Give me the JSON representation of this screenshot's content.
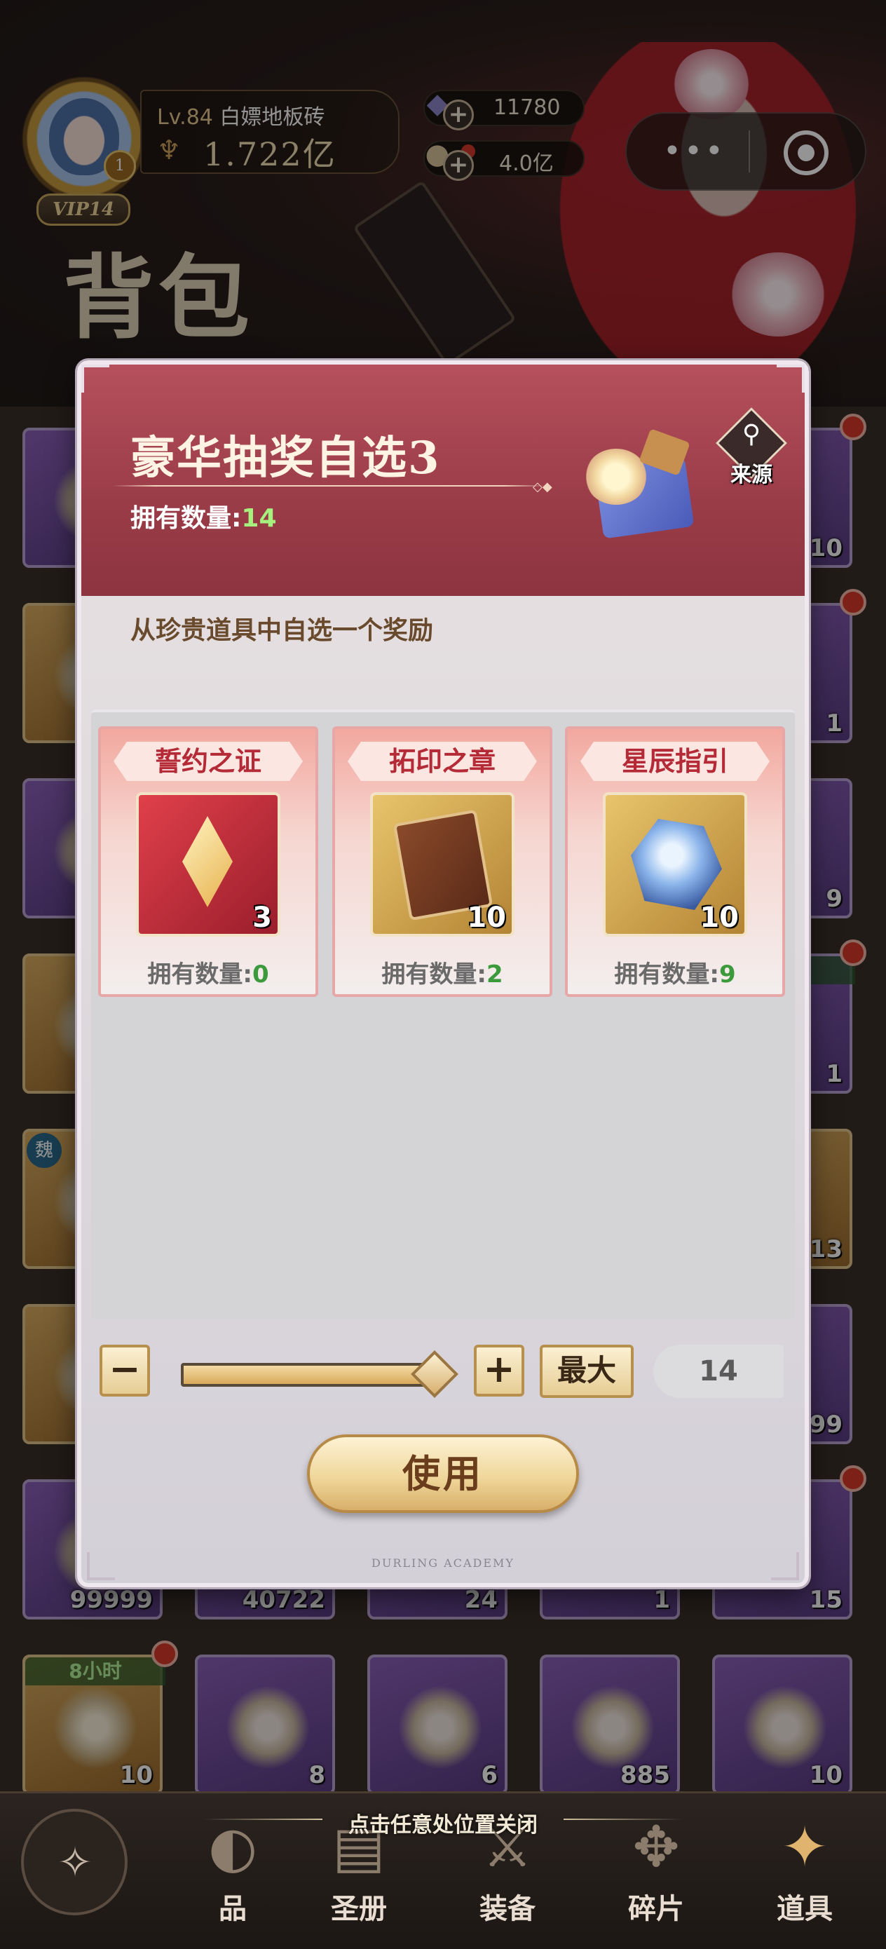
{
  "player": {
    "level_label": "Lv.",
    "level": "84",
    "name": "白嫖地板砖",
    "power": "1.722亿",
    "vip_label": "VIP14",
    "avatar_badge": "1"
  },
  "resources": [
    {
      "name": "gem",
      "value": "11780"
    },
    {
      "name": "coin",
      "value": "4.0亿"
    }
  ],
  "header_title": "背包",
  "modal": {
    "title": "豪华抽奖自选3",
    "owned_label": "拥有数量:",
    "owned_value": "14",
    "source_label": "来源",
    "description": "从珍贵道具中自选一个奖励",
    "options": [
      {
        "name": "誓约之证",
        "qty": "3",
        "owned_label": "拥有数量:",
        "owned_value": "0",
        "icon": "red-crystal-card-icon"
      },
      {
        "name": "拓印之章",
        "qty": "10",
        "owned_label": "拥有数量:",
        "owned_value": "2",
        "icon": "book-icon"
      },
      {
        "name": "星辰指引",
        "qty": "10",
        "owned_label": "拥有数量:",
        "owned_value": "9",
        "icon": "star-crystal-icon"
      }
    ],
    "minus_label": "−",
    "plus_label": "+",
    "max_label": "最大",
    "selected_qty": "14",
    "slider_fraction": 1.0,
    "use_label": "使用",
    "footer": "DURLING ACADEMY"
  },
  "grid_qty": {
    "r1c5": "10",
    "r2c5": "1",
    "r3c5": "9",
    "r4c5": "1",
    "r5c5": "13",
    "r6c5": "999",
    "r7c1": "99999",
    "r7c2": "40722",
    "r7c3": "24",
    "r7c4": "1",
    "r7c5": "15",
    "r8c1": "10",
    "r8c2": "8",
    "r8c3": "6",
    "r8c4": "885",
    "r8c5": "10"
  },
  "grid_tags": {
    "r4c5": "时",
    "r8c1": "8小时",
    "r5c1": "魏"
  },
  "close_hint": "点击任意处位置关闭",
  "bottom_nav": [
    {
      "label": "品",
      "icon": "item-icon"
    },
    {
      "label": "圣册",
      "icon": "book-nav-icon"
    },
    {
      "label": "装备",
      "icon": "equipment-icon"
    },
    {
      "label": "碎片",
      "icon": "puzzle-icon"
    },
    {
      "label": "道具",
      "icon": "props-icon",
      "active": true
    }
  ],
  "colors": {
    "header_red": "#9a3c48",
    "owned_green": "#a6f07e",
    "option_title_red": "#b42a36",
    "gold_button": "#f0d79b"
  }
}
